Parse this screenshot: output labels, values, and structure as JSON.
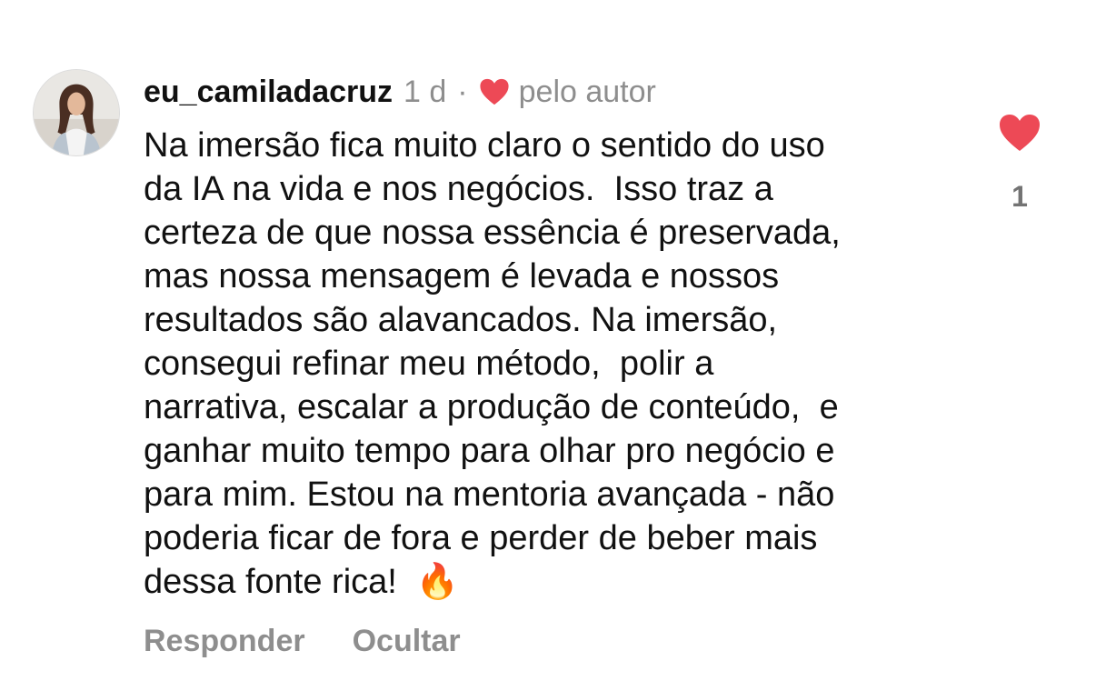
{
  "comment": {
    "username": "eu_camiladacruz",
    "time": "1 d",
    "separator": "·",
    "liked_by_author": "pelo autor",
    "text": "Na imersão fica muito claro o sentido do uso\nda IA na vida e nos negócios.  Isso traz a\ncerteza de que nossa essência é preservada,\nmas nossa mensagem é levada e nossos\nresultados são alavancados. Na imersão,\nconsegui refinar meu método,  polir a\nnarrativa, escalar a produção de conteúdo,  e\nganhar muito tempo para olhar pro negócio e\npara mim. Estou na mentoria avançada - não\npoderia ficar de fora e perder de beber mais\ndessa fonte rica!  🔥",
    "like_count": "1",
    "reply_label": "Responder",
    "hide_label": "Ocultar"
  },
  "icons": {
    "like": "heart-icon-filled",
    "author_like": "heart-icon-filled",
    "avatar": "profile-photo"
  },
  "colors": {
    "heart": "#ed4956",
    "secondary_text": "#8e8e8e",
    "primary_text": "#111111"
  }
}
